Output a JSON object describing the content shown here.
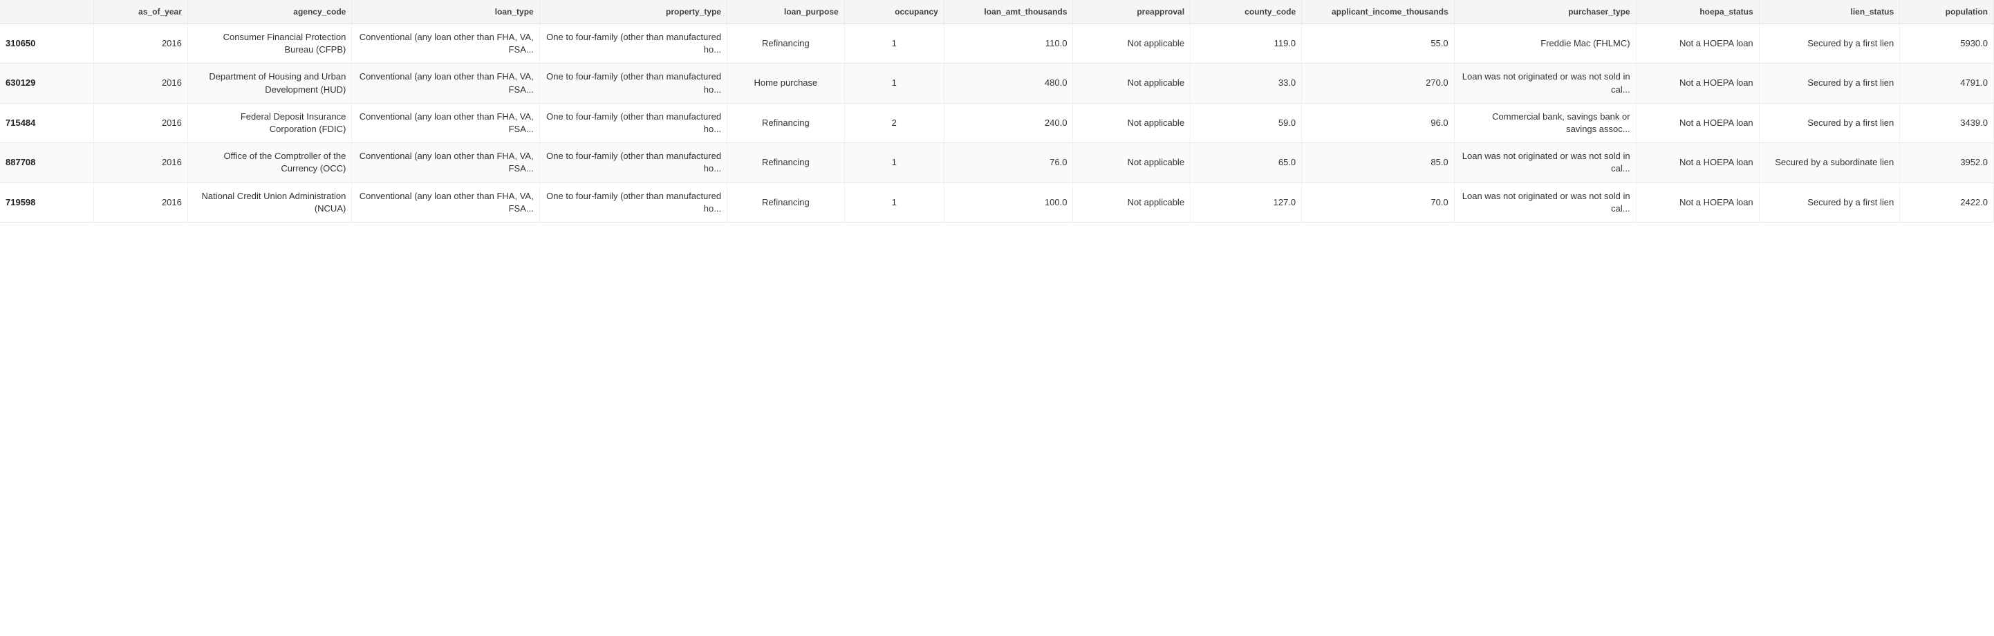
{
  "table": {
    "columns": [
      {
        "key": "id",
        "label": "",
        "align": "left"
      },
      {
        "key": "as_of_year",
        "label": "as_of_year",
        "align": "right"
      },
      {
        "key": "agency_code",
        "label": "agency_code",
        "align": "right"
      },
      {
        "key": "loan_type",
        "label": "loan_type",
        "align": "right"
      },
      {
        "key": "property_type",
        "label": "property_type",
        "align": "right"
      },
      {
        "key": "loan_purpose",
        "label": "loan_purpose",
        "align": "center"
      },
      {
        "key": "occupancy",
        "label": "occupancy",
        "align": "center"
      },
      {
        "key": "loan_amt_thousands",
        "label": "loan_amt_thousands",
        "align": "right"
      },
      {
        "key": "preapproval",
        "label": "preapproval",
        "align": "right"
      },
      {
        "key": "county_code",
        "label": "county_code",
        "align": "right"
      },
      {
        "key": "applicant_income_thousands",
        "label": "applicant_income_thousands",
        "align": "right"
      },
      {
        "key": "purchaser_type",
        "label": "purchaser_type",
        "align": "right"
      },
      {
        "key": "hoepa_status",
        "label": "hoepa_status",
        "align": "right"
      },
      {
        "key": "lien_status",
        "label": "lien_status",
        "align": "right"
      },
      {
        "key": "population",
        "label": "population",
        "align": "right"
      }
    ],
    "rows": [
      {
        "id": "310650",
        "as_of_year": "2016",
        "agency_code": "Consumer Financial Protection Bureau (CFPB)",
        "loan_type": "Conventional (any loan other than FHA, VA, FSA...",
        "property_type": "One to four-family (other than manufactured ho...",
        "loan_purpose": "Refinancing",
        "occupancy": "1",
        "loan_amt_thousands": "110.0",
        "preapproval": "Not applicable",
        "county_code": "119.0",
        "applicant_income_thousands": "55.0",
        "purchaser_type": "Freddie Mac (FHLMC)",
        "hoepa_status": "Not a HOEPA loan",
        "lien_status": "Secured by a first lien",
        "population": "5930.0"
      },
      {
        "id": "630129",
        "as_of_year": "2016",
        "agency_code": "Department of Housing and Urban Development (HUD)",
        "loan_type": "Conventional (any loan other than FHA, VA, FSA...",
        "property_type": "One to four-family (other than manufactured ho...",
        "loan_purpose": "Home purchase",
        "occupancy": "1",
        "loan_amt_thousands": "480.0",
        "preapproval": "Not applicable",
        "county_code": "33.0",
        "applicant_income_thousands": "270.0",
        "purchaser_type": "Loan was not originated or was not sold in cal...",
        "hoepa_status": "Not a HOEPA loan",
        "lien_status": "Secured by a first lien",
        "population": "4791.0"
      },
      {
        "id": "715484",
        "as_of_year": "2016",
        "agency_code": "Federal Deposit Insurance Corporation (FDIC)",
        "loan_type": "Conventional (any loan other than FHA, VA, FSA...",
        "property_type": "One to four-family (other than manufactured ho...",
        "loan_purpose": "Refinancing",
        "occupancy": "2",
        "loan_amt_thousands": "240.0",
        "preapproval": "Not applicable",
        "county_code": "59.0",
        "applicant_income_thousands": "96.0",
        "purchaser_type": "Commercial bank, savings bank or savings assoc...",
        "hoepa_status": "Not a HOEPA loan",
        "lien_status": "Secured by a first lien",
        "population": "3439.0"
      },
      {
        "id": "887708",
        "as_of_year": "2016",
        "agency_code": "Office of the Comptroller of the Currency (OCC)",
        "loan_type": "Conventional (any loan other than FHA, VA, FSA...",
        "property_type": "One to four-family (other than manufactured ho...",
        "loan_purpose": "Refinancing",
        "occupancy": "1",
        "loan_amt_thousands": "76.0",
        "preapproval": "Not applicable",
        "county_code": "65.0",
        "applicant_income_thousands": "85.0",
        "purchaser_type": "Loan was not originated or was not sold in cal...",
        "hoepa_status": "Not a HOEPA loan",
        "lien_status": "Secured by a subordinate lien",
        "population": "3952.0"
      },
      {
        "id": "719598",
        "as_of_year": "2016",
        "agency_code": "National Credit Union Administration (NCUA)",
        "loan_type": "Conventional (any loan other than FHA, VA, FSA...",
        "property_type": "One to four-family (other than manufactured ho...",
        "loan_purpose": "Refinancing",
        "occupancy": "1",
        "loan_amt_thousands": "100.0",
        "preapproval": "Not applicable",
        "county_code": "127.0",
        "applicant_income_thousands": "70.0",
        "purchaser_type": "Loan was not originated or was not sold in cal...",
        "hoepa_status": "Not a HOEPA loan",
        "lien_status": "Secured by a first lien",
        "population": "2422.0"
      }
    ]
  }
}
